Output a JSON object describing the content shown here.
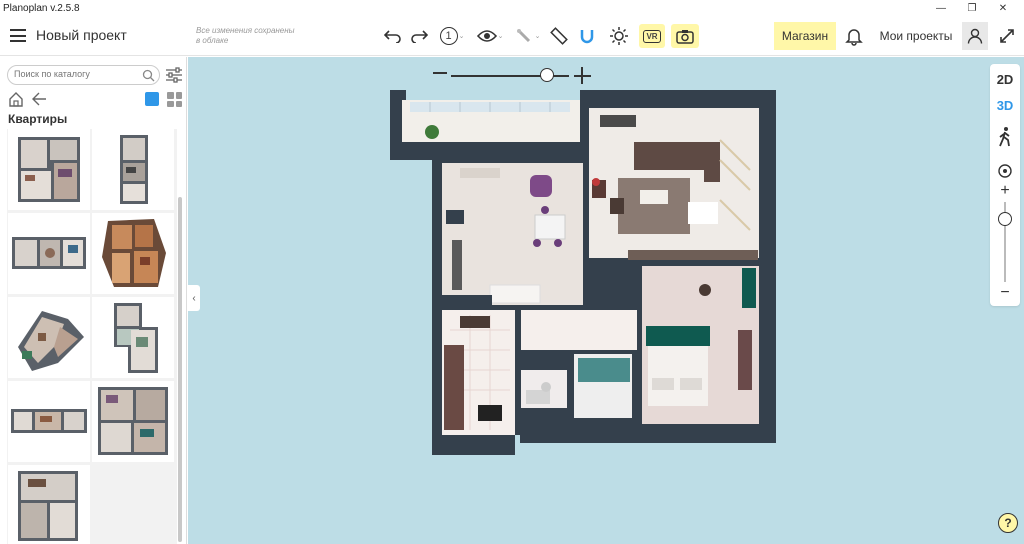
{
  "window": {
    "title": "Planoplan v.2.5.8",
    "minimize_glyph": "—",
    "restore_glyph": "❐",
    "close_glyph": "✕"
  },
  "toolbar": {
    "project_name": "Новый проект",
    "save_status": "Все изменения сохранены в облаке",
    "level_label": "1",
    "vr_label": "VR",
    "shop_label": "Магазин",
    "my_projects_label": "Мои проекты",
    "icons": [
      "menu-icon",
      "undo-icon",
      "redo-icon",
      "eye-icon",
      "brush-icon",
      "ruler-icon",
      "magnet-icon",
      "sun-icon",
      "vr-icon",
      "camera-icon",
      "bell-icon",
      "user-icon",
      "expand-icon"
    ],
    "accent_color": "#fff7a8"
  },
  "sidebar": {
    "search_placeholder": "Поиск по каталогу",
    "category_title": "Квартиры",
    "thumbnail_count": 9,
    "active_view_color": "#2f97e8"
  },
  "canvas": {
    "collapse_glyph": "‹",
    "view_2d": "2D",
    "view_3d": "3D",
    "active_view": "3D",
    "zoom_plus": "+",
    "zoom_minus": "−",
    "help_glyph": "?",
    "background_color": "#bddde6",
    "wall_color": "#34404c"
  }
}
